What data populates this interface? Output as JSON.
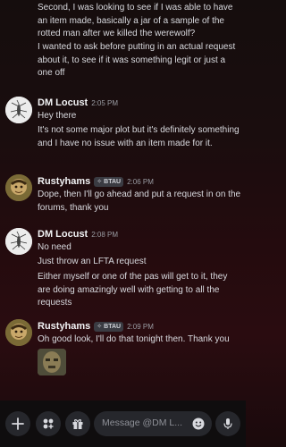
{
  "messages": {
    "top_continuation": [
      "Second, I was looking to see if I was able to have an item made, basically a jar of a sample of the rotted man after we killed the werewolf?",
      "I wanted to ask before putting in an actual request about it, to see if it was something legit or just a one off"
    ],
    "m1": {
      "author": "DM Locust",
      "time": "2:05 PM",
      "lines": [
        "Hey there",
        "It's not some major plot but it's definitely something and I have no issue with an item made for it."
      ]
    },
    "m2": {
      "author": "Rustyhams",
      "tag": "BTAU",
      "time": "2:06 PM",
      "lines": [
        "Dope, then I'll go ahead and put a request in on the forums, thank you"
      ]
    },
    "m3": {
      "author": "DM Locust",
      "time": "2:08 PM",
      "lines": [
        "No need",
        "Just throw an LFTA request",
        "Either myself or one of the pas will get to it, they are doing amazingly well with getting to all the requests"
      ]
    },
    "m4": {
      "author": "Rustyhams",
      "tag": "BTAU",
      "time": "2:09 PM",
      "lines": [
        "Oh good look, I'll do that tonight then. Thank you"
      ]
    }
  },
  "composer": {
    "placeholder": "Message @DM L...",
    "icons": [
      "plus-icon",
      "apps-icon",
      "gift-icon",
      "emoji-icon",
      "mic-icon"
    ]
  },
  "colors": {
    "tag_bg": "#3a3b42",
    "bar_bg": "#0f0d0e",
    "input_bg": "#26272c"
  }
}
